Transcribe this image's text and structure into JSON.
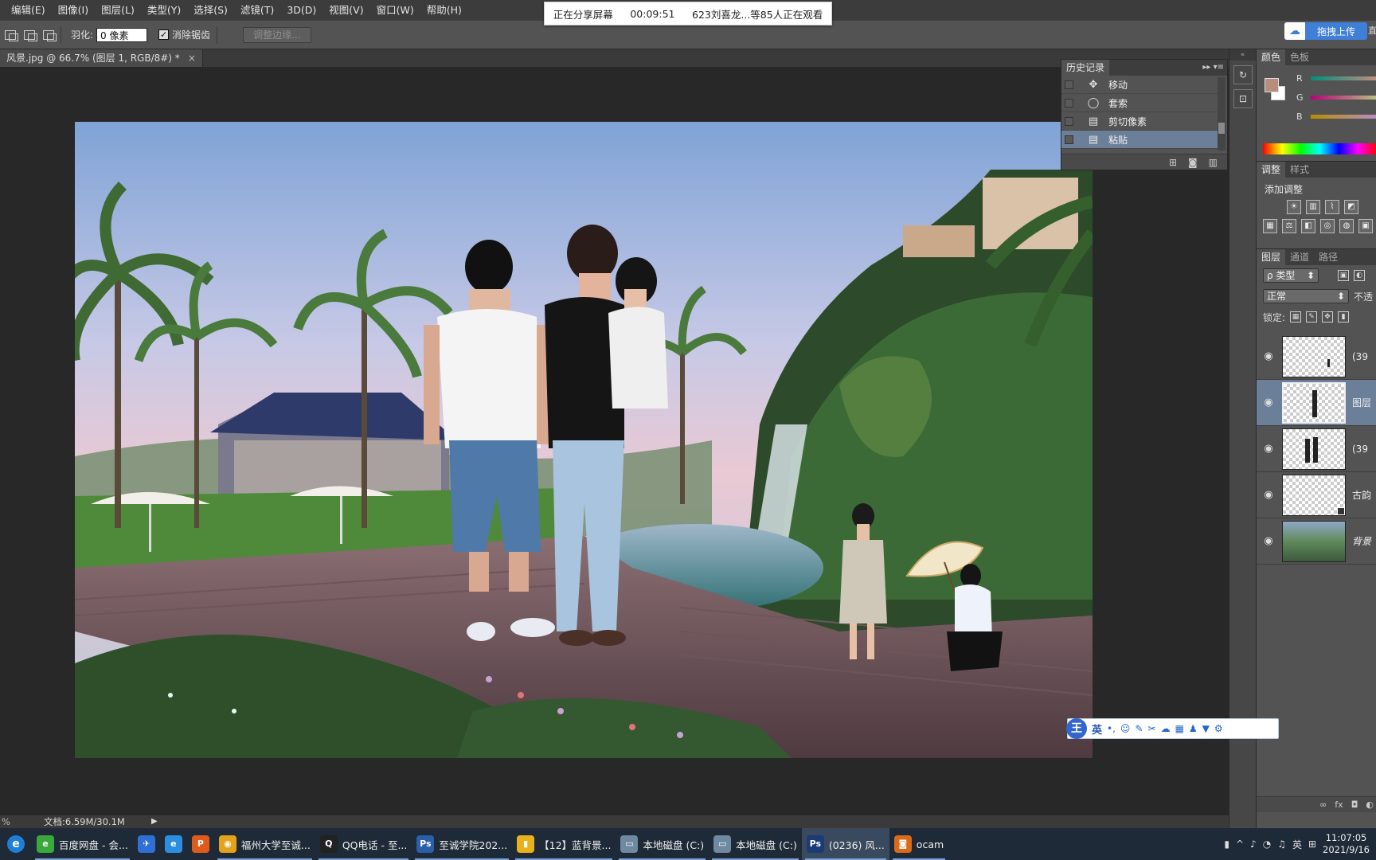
{
  "menu": [
    "编辑(E)",
    "图像(I)",
    "图层(L)",
    "类型(Y)",
    "选择(S)",
    "滤镜(T)",
    "3D(D)",
    "视图(V)",
    "窗口(W)",
    "帮助(H)"
  ],
  "share": {
    "status": "正在分享屏幕",
    "time": "00:09:51",
    "viewers": "623刘喜龙...等85人正在观看"
  },
  "options": {
    "feather_label": "羽化:",
    "feather_value": "0 像素",
    "antialias_label": "消除锯齿",
    "refine_edge": "调整边缘..."
  },
  "upload": {
    "label": "拖拽上传",
    "edge_text": "直"
  },
  "document_tab": {
    "title": "风景.jpg @ 66.7% (图层 1, RGB/8#) *",
    "close": "×"
  },
  "history": {
    "tab": "历史记录",
    "items": [
      {
        "icon": "move-icon",
        "glyph": "✥",
        "label": "移动",
        "active": false
      },
      {
        "icon": "lasso-icon",
        "glyph": "◯",
        "label": "套索",
        "active": false
      },
      {
        "icon": "document-icon",
        "glyph": "▤",
        "label": "剪切像素",
        "active": false
      },
      {
        "icon": "document-icon",
        "glyph": "▤",
        "label": "粘贴",
        "active": true
      }
    ]
  },
  "color_panel": {
    "tabs": [
      "颜色",
      "色板"
    ],
    "channels": [
      "R",
      "G",
      "B"
    ],
    "fg_color": "#b78e7e",
    "bg_color": "#ffffff"
  },
  "adjust_panel": {
    "tabs": [
      "调整",
      "样式"
    ],
    "title": "添加调整"
  },
  "layers_panel": {
    "tabs": [
      "图层",
      "通道",
      "路径"
    ],
    "filter": "ρ 类型",
    "blend_mode": "正常",
    "opacity_label": "不透",
    "lock_label": "锁定:",
    "layers": [
      {
        "name": "(39",
        "active": false
      },
      {
        "name": "图层",
        "active": true
      },
      {
        "name": "(39",
        "active": false
      },
      {
        "name": "古韵",
        "active": false
      },
      {
        "name": "背景",
        "active": false
      }
    ],
    "bottom_icons": [
      "∞",
      "fx",
      "◘",
      "◐"
    ]
  },
  "ime": {
    "logo": "王",
    "mode": "英"
  },
  "statusbar": {
    "zoom": "%",
    "doc": "文档:6.59M/30.1M"
  },
  "taskbar": {
    "items": [
      {
        "label": "百度网盘 - 会...",
        "icon_color": "#3aa83a",
        "icon": "e"
      },
      {
        "label": "",
        "icon_color": "#2f6fd6",
        "icon": "✈"
      },
      {
        "label": "",
        "icon_color": "#2b8ee0",
        "icon": "e"
      },
      {
        "label": "",
        "icon_color": "#e05a1c",
        "icon": "P"
      },
      {
        "label": "福州大学至诚...",
        "icon_color": "#e2a21c",
        "icon": "◉"
      },
      {
        "label": "QQ电话 - 至...",
        "icon_color": "#222222",
        "icon": "Q"
      },
      {
        "label": "至诚学院202...",
        "icon_color": "#2b5fa8",
        "icon": "Ps"
      },
      {
        "label": "【12】蓝背景...",
        "icon_color": "#e8b21c",
        "icon": "▮"
      },
      {
        "label": "本地磁盘 (C:)",
        "icon_color": "#6f8aa0",
        "icon": "▭"
      },
      {
        "label": "本地磁盘 (C:)",
        "icon_color": "#6f8aa0",
        "icon": "▭"
      },
      {
        "label": "(0236) 风...",
        "icon_color": "#1a3b73",
        "icon": "Ps"
      },
      {
        "label": "ocam",
        "icon_color": "#d96a1a",
        "icon": "◙"
      }
    ],
    "tray_lang": "英",
    "time": "11:07:05",
    "date": "2021/9/16"
  }
}
